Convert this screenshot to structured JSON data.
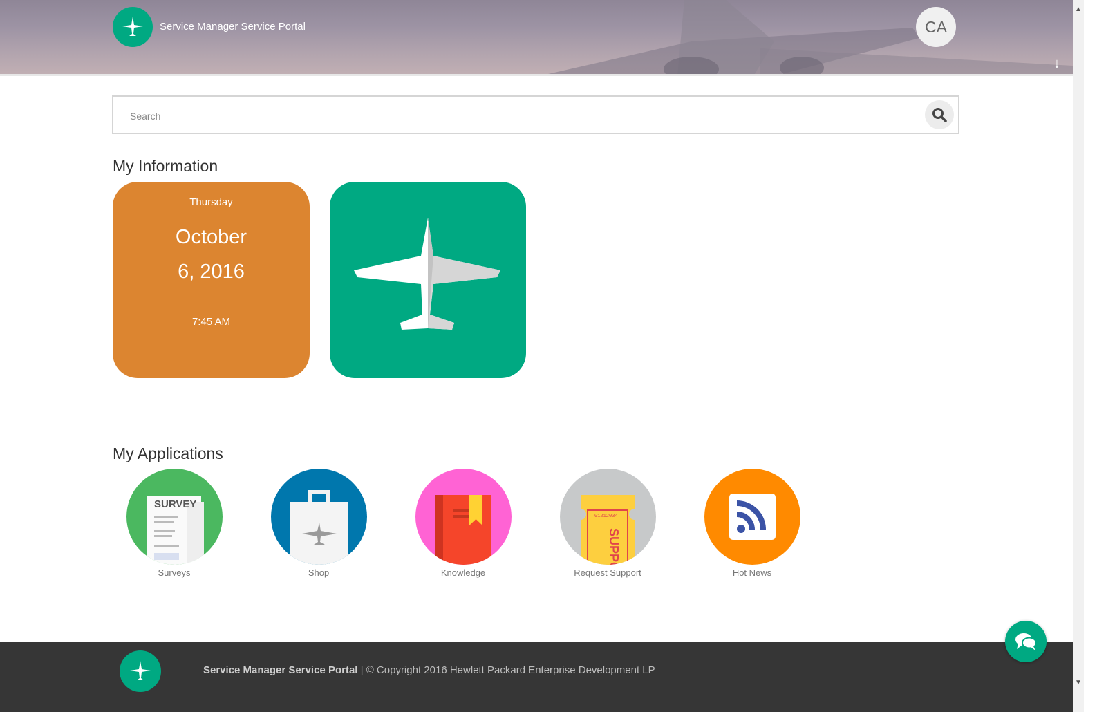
{
  "header": {
    "portal_title": "Service Manager Service Portal",
    "avatar_initials": "CA"
  },
  "search": {
    "placeholder": "Search",
    "value": ""
  },
  "my_information": {
    "title": "My Information",
    "date_tile": {
      "weekday": "Thursday",
      "month": "October",
      "day_year": "6, 2016",
      "time": "7:45 AM"
    }
  },
  "my_applications": {
    "title": "My Applications",
    "apps": [
      {
        "label": "Surveys",
        "icon": "survey-icon",
        "color": "#4bb860"
      },
      {
        "label": "Shop",
        "icon": "shopping-bag-icon",
        "color": "#0077ad"
      },
      {
        "label": "Knowledge",
        "icon": "book-icon",
        "color": "#ff63d4"
      },
      {
        "label": "Request Support",
        "icon": "support-ticket-icon",
        "color": "#c7c9ca"
      },
      {
        "label": "Hot News",
        "icon": "rss-icon",
        "color": "#ff8a00"
      }
    ]
  },
  "footer": {
    "portal_name": "Service Manager Service Portal",
    "copyright": "| © Copyright 2016 Hewlett Packard Enterprise Development LP"
  },
  "colors": {
    "brand_green": "#00a982",
    "date_tile_orange": "#dc8530",
    "footer_bg": "#363636"
  }
}
